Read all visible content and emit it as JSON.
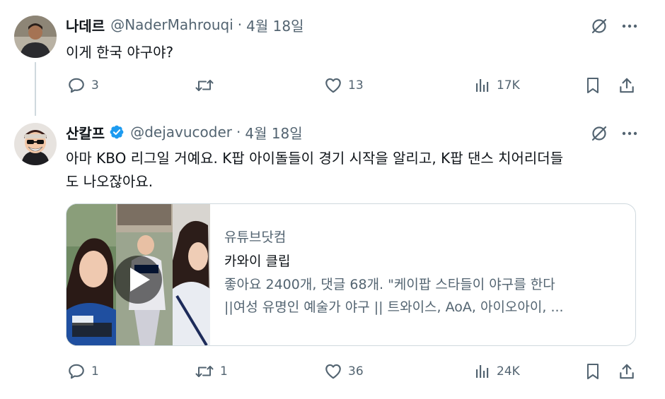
{
  "tweets": [
    {
      "author_name": "나데르",
      "handle": "@NaderMahrouqi",
      "separator": "·",
      "date": "4월 18일",
      "text": "이게 한국 야구야?",
      "replies": "3",
      "retweets": "",
      "likes": "13",
      "views": "17K"
    },
    {
      "author_name": "산칼프",
      "handle": "@dejavucoder",
      "separator": "·",
      "date": "4월 18일",
      "verified": true,
      "text_line1": "아마 KBO 리그일 거예요. K팝 아이돌들이 경기 시작을 알리고, K팝 댄스 치어리더들",
      "text_line2": "도 나오잖아요.",
      "card": {
        "site": "유튜브닷컴",
        "title": "카와이 클립",
        "desc_line1": "좋아요 2400개, 댓글 68개. \"케이팝 스타들이 야구를 한다",
        "desc_line2": "||여성 유명인 예술가 야구 || 트와이스, AoA, 아이오아이, ..."
      },
      "replies": "1",
      "retweets": "1",
      "likes": "36",
      "views": "24K"
    }
  ],
  "icons": {
    "grok": "grok-icon",
    "more": "more-icon",
    "reply": "reply-icon",
    "retweet": "retweet-icon",
    "like": "like-icon",
    "views": "views-icon",
    "bookmark": "bookmark-icon",
    "share": "share-icon",
    "play": "play-icon"
  },
  "colors": {
    "text": "#0f1419",
    "muted": "#536471",
    "border": "#cfd9de",
    "verified": "#1d9bf0"
  }
}
